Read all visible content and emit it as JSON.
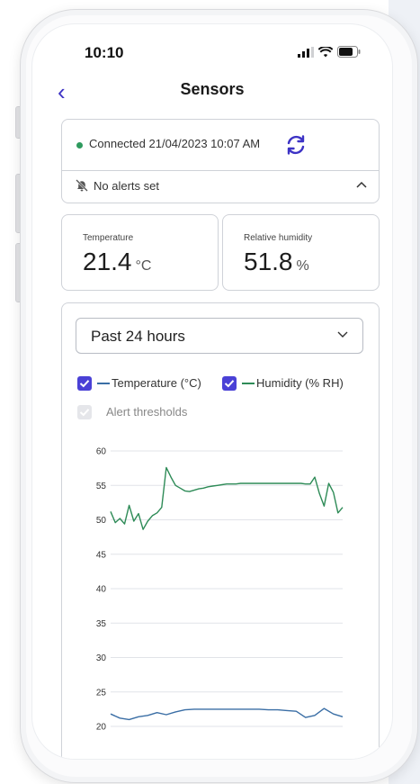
{
  "status_bar": {
    "time": "10:10"
  },
  "nav": {
    "title": "Sensors"
  },
  "connection": {
    "status_text": "Connected 21/04/2023 10:07 AM",
    "alerts_text": "No alerts set"
  },
  "metrics": [
    {
      "label": "Temperature",
      "value": "21.4",
      "unit": "°C"
    },
    {
      "label": "Relative humidity",
      "value": "51.8",
      "unit": "%"
    }
  ],
  "range_select": {
    "selected": "Past 24 hours"
  },
  "legend": {
    "temperature": "Temperature (°C)",
    "humidity": "Humidity (% RH)",
    "alert_thresholds": "Alert thresholds"
  },
  "colors": {
    "accent": "#4a41d6",
    "humidity_line": "#2e8b57",
    "temperature_line": "#3a6ea5",
    "connected_dot": "#2e9a5e"
  },
  "chart_data": {
    "type": "line",
    "title": "",
    "xlabel": "",
    "ylabel": "",
    "ylim": [
      20,
      60
    ],
    "yticks": [
      60,
      55,
      50,
      45,
      40,
      35,
      30,
      25,
      20
    ],
    "grid": true,
    "series": [
      {
        "name": "Humidity (% RH)",
        "color": "#2e8b57",
        "x": [
          0,
          2,
          4,
          6,
          8,
          10,
          12,
          14,
          16,
          18,
          20,
          22,
          24,
          26,
          28,
          30,
          32,
          34,
          36,
          38,
          40,
          42,
          44,
          46,
          48,
          50,
          52,
          54,
          56,
          58,
          60,
          62,
          64,
          66,
          68,
          70,
          72,
          74,
          76,
          78,
          80,
          82,
          84,
          86,
          88,
          90,
          92,
          94,
          96,
          98,
          100
        ],
        "y": [
          51.2,
          49.6,
          50.2,
          49.4,
          52.1,
          49.8,
          50.9,
          48.6,
          49.8,
          50.6,
          51.0,
          51.8,
          57.6,
          56.2,
          55.0,
          54.6,
          54.2,
          54.1,
          54.3,
          54.5,
          54.6,
          54.8,
          54.9,
          55.0,
          55.1,
          55.2,
          55.2,
          55.2,
          55.3,
          55.3,
          55.3,
          55.3,
          55.3,
          55.3,
          55.3,
          55.3,
          55.3,
          55.3,
          55.3,
          55.3,
          55.3,
          55.3,
          55.2,
          55.2,
          56.2,
          53.8,
          52.0,
          55.3,
          54.0,
          51.0,
          51.8
        ]
      },
      {
        "name": "Temperature (°C)",
        "color": "#3a6ea5",
        "x": [
          0,
          4,
          8,
          12,
          16,
          20,
          24,
          28,
          32,
          36,
          40,
          44,
          48,
          52,
          56,
          60,
          64,
          68,
          72,
          76,
          80,
          84,
          88,
          92,
          96,
          100
        ],
        "y": [
          21.8,
          21.2,
          21.0,
          21.4,
          21.6,
          22.0,
          21.7,
          22.1,
          22.4,
          22.5,
          22.5,
          22.5,
          22.5,
          22.5,
          22.5,
          22.5,
          22.5,
          22.4,
          22.4,
          22.3,
          22.2,
          21.3,
          21.6,
          22.6,
          21.8,
          21.4
        ]
      }
    ]
  }
}
